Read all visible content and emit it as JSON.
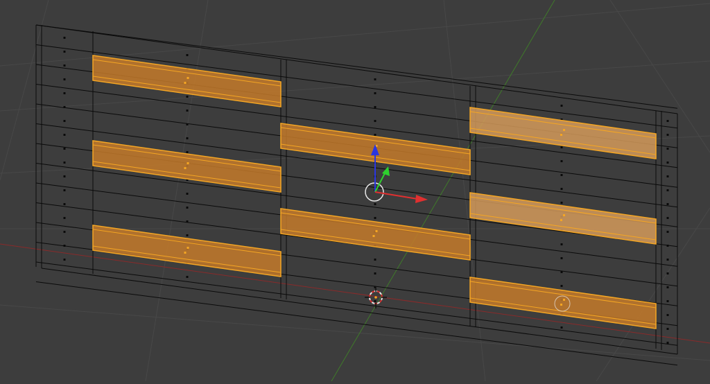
{
  "app": {
    "name": "",
    "view": "3D Viewport"
  },
  "viewport": {
    "background_color": "#3d3d3d",
    "grid_color": "#484848",
    "x_axis_color": "#8a2a2a",
    "y_axis_color": "#3f7a2a",
    "wire_color": "#0a0a0a",
    "selection_fill": "#c47a2a",
    "selection_stroke": "#f5a623",
    "active_selection_fill": "#d39a5a",
    "gizmo": {
      "x_color": "#e03030",
      "y_color": "#2ed12e",
      "z_color": "#2a36e0",
      "center_ring_color": "#e8e8e8",
      "icon": "transform-gizmo-icon"
    },
    "cursor": {
      "icon": "3d-cursor-icon",
      "colors": [
        "#e8e8e8",
        "#d83030"
      ]
    },
    "selected_object_count": 8,
    "active_object_icon": "active-object-ring-icon"
  }
}
